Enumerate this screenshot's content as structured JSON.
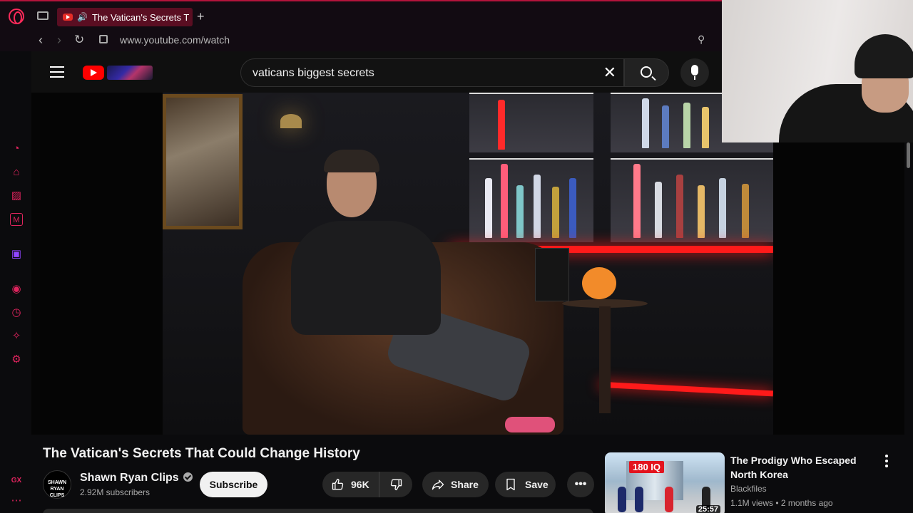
{
  "browser": {
    "tab_title": "The Vatican's Secrets T",
    "new_tab_symbol": "+",
    "url": "www.youtube.com/watch",
    "back_symbol": "‹",
    "forward_symbol": "›",
    "reload_symbol": "↻",
    "sidebar_logo_text": "GX",
    "accent_color": "#ff2a5a"
  },
  "youtube": {
    "search_query": "vaticans biggest secrets",
    "search_clear_symbol": "✕"
  },
  "video": {
    "title": "The Vatican's Secrets That Could Change History",
    "channel_name": "Shawn Ryan Clips",
    "channel_avatar_text": "SHAWN RYAN CLIPS",
    "subscribers": "2.92M subscribers",
    "subscribe_label": "Subscribe",
    "likes": "96K",
    "share_label": "Share",
    "save_label": "Save",
    "more_symbol": "•••"
  },
  "recommendation": {
    "title": "The Prodigy Who Escaped North Korea",
    "channel": "Blackfiles",
    "meta": "1.1M views • 2 months ago",
    "duration": "25:57",
    "thumb_badge": "180 IQ"
  }
}
